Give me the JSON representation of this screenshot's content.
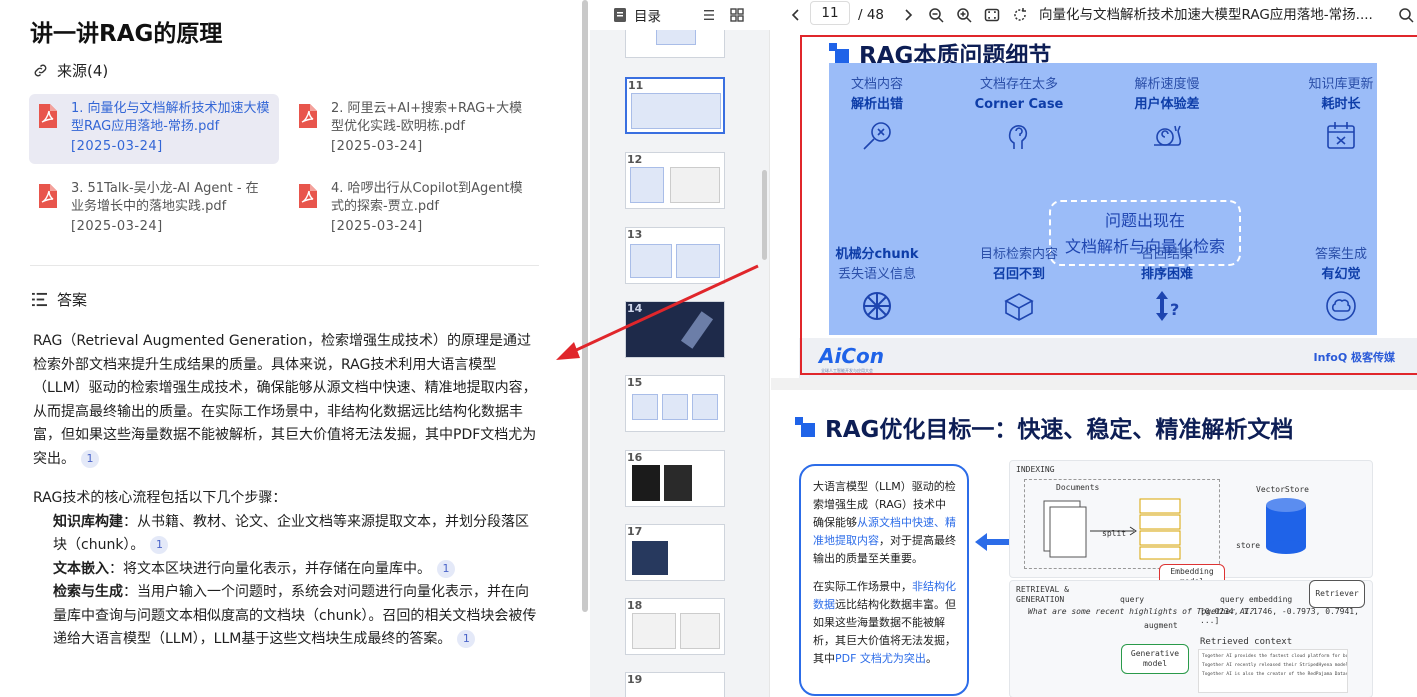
{
  "page_title": "讲一讲RAG的原理",
  "sources": {
    "heading": "来源(4)",
    "items": [
      {
        "name": "1. 向量化与文档解析技术加速大模型RAG应用落地-常扬.pdf",
        "date": "[2025-03-24]"
      },
      {
        "name": "2. 阿里云+AI+搜索+RAG+大模型优化实践-欧明栋.pdf",
        "date": "[2025-03-24]"
      },
      {
        "name": "3. 51Talk-吴小龙-AI Agent - 在业务增长中的落地实践.pdf",
        "date": "[2025-03-24]"
      },
      {
        "name": "4. 哈啰出行从Copilot到Agent模式的探索-贾立.pdf",
        "date": "[2025-03-24]"
      }
    ]
  },
  "answer": {
    "heading": "答案",
    "para1": "RAG（Retrieval Augmented Generation，检索增强生成技术）的原理是通过检索外部文档来提升生成结果的质量。具体来说，RAG技术利用大语言模型（LLM）驱动的检索增强生成技术，确保能够从源文档中快速、精准地提取内容，从而提高最终输出的质量。在实际工作场景中，非结构化数据远比结构化数据丰富，但如果这些海量数据不能被解析，其巨大价值将无法发掘，其中PDF文档尤为突出。",
    "para2_intro": "RAG技术的核心流程包括以下几个步骤：",
    "steps": [
      {
        "label": "知识库构建",
        "text": "：从书籍、教材、论文、企业文档等来源提取文本，并划分段落区块（chunk）。"
      },
      {
        "label": "文本嵌入",
        "text": "：将文本区块进行向量化表示，并存储在向量库中。"
      },
      {
        "label": "检索与生成",
        "text": "：当用户输入一个问题时，系统会对问题进行向量化表示，并在向量库中查询与问题文本相似度高的文档块（chunk）。召回的相关文档块会被传递给大语言模型（LLM），LLM基于这些文档块生成最终的答案。"
      }
    ],
    "cite": "1"
  },
  "viewer": {
    "toc_label": "目录",
    "current_page": "11",
    "total_pages": "/ 48",
    "doc_title": "向量化与文档解析技术加速大模型RAG应用落地-常扬....",
    "thumbs": [
      "11",
      "12",
      "13",
      "14",
      "15",
      "16",
      "17",
      "18",
      "19"
    ]
  },
  "slide1": {
    "title": "RAG本质问题细节",
    "top_cells": [
      {
        "line1": "文档内容",
        "line2": "解析出错"
      },
      {
        "line1": "文档存在太多",
        "line2": "Corner Case"
      },
      {
        "line1": "解析速度慢",
        "line2": "用户体验差"
      },
      {
        "line1": "知识库更新",
        "line2": "耗时长"
      }
    ],
    "center_line1": "问题出现在",
    "center_line2": "文档解析与向量化检索",
    "bottom_cells": [
      {
        "line1": "机械分chunk",
        "line2": "丢失语义信息"
      },
      {
        "line1": "目标检索内容",
        "line2": "召回不到"
      },
      {
        "line1": "召回结果",
        "line2": "排序困难"
      },
      {
        "line1": "答案生成",
        "line2": "有幻觉"
      }
    ],
    "footer_left": "AiCon",
    "footer_left_sub": "全球人工智能开发与应用大会",
    "footer_right": "InfoQ 极客传媒"
  },
  "slide2": {
    "title": "RAG优化目标一：快速、稳定、精准解析文档",
    "bubble_p1_a": "大语言模型（LLM）驱动的检索增强生成（RAG）技术中确保能够",
    "bubble_p1_hl": "从源文档中快速、精准地提取内容",
    "bubble_p1_b": "，对于提高最终输出的质量至关重要。",
    "bubble_p2_a": "在实际工作场景中，",
    "bubble_p2_hl": "非结构化数据",
    "bubble_p2_b": "远比结构化数据丰富。但如果这些海量数据不能被解析，其巨大价值将无法发掘，其中",
    "bubble_p2_hl2": "PDF 文档尤为突出",
    "bubble_p2_c": "。",
    "diagram": {
      "indexing": "INDEXING",
      "documents": "Documents",
      "vectorstore": "VectorStore",
      "split": "split",
      "store": "store",
      "embedding": "Embedding model",
      "retrieval": "RETRIEVAL & GENERATION",
      "query": "query",
      "question": "What are some recent highlights of Together AI?",
      "query_embedding": "query embedding",
      "embedding_values": "[0.0234, 1.1746, -0.7973, 0.7941, ...]",
      "retriever": "Retriever",
      "augment": "augment",
      "generative": "Generative model",
      "retrieved_context": "Retrieved context",
      "context_lines": [
        "Together AI provides the fastest cloud platform for building ...",
        "Together AI recently released their StripedHyena models, which ...",
        "Together AI is also the creator of the RedPajama Datasets..."
      ]
    }
  }
}
